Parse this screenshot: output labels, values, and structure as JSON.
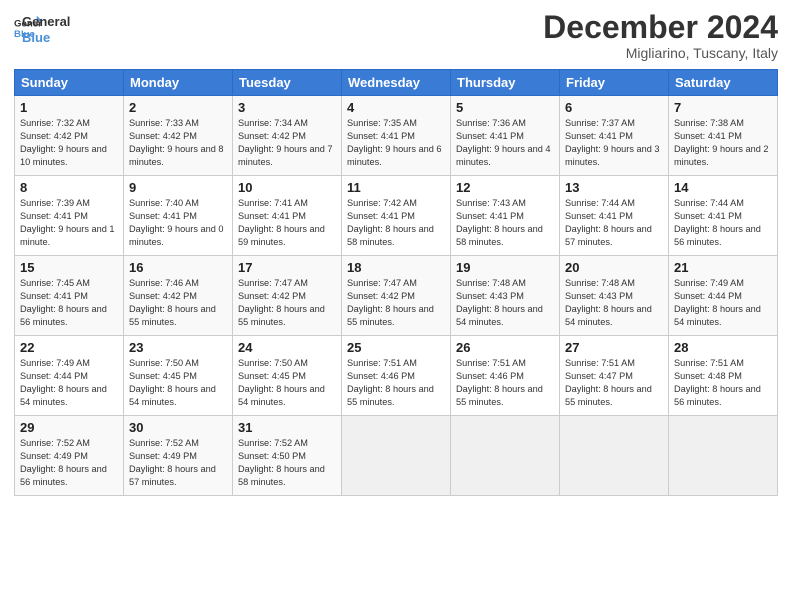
{
  "logo": {
    "line1": "General",
    "line2": "Blue"
  },
  "title": "December 2024",
  "location": "Migliarino, Tuscany, Italy",
  "days_of_week": [
    "Sunday",
    "Monday",
    "Tuesday",
    "Wednesday",
    "Thursday",
    "Friday",
    "Saturday"
  ],
  "weeks": [
    [
      {
        "day": "1",
        "info": "Sunrise: 7:32 AM\nSunset: 4:42 PM\nDaylight: 9 hours and 10 minutes."
      },
      {
        "day": "2",
        "info": "Sunrise: 7:33 AM\nSunset: 4:42 PM\nDaylight: 9 hours and 8 minutes."
      },
      {
        "day": "3",
        "info": "Sunrise: 7:34 AM\nSunset: 4:42 PM\nDaylight: 9 hours and 7 minutes."
      },
      {
        "day": "4",
        "info": "Sunrise: 7:35 AM\nSunset: 4:41 PM\nDaylight: 9 hours and 6 minutes."
      },
      {
        "day": "5",
        "info": "Sunrise: 7:36 AM\nSunset: 4:41 PM\nDaylight: 9 hours and 4 minutes."
      },
      {
        "day": "6",
        "info": "Sunrise: 7:37 AM\nSunset: 4:41 PM\nDaylight: 9 hours and 3 minutes."
      },
      {
        "day": "7",
        "info": "Sunrise: 7:38 AM\nSunset: 4:41 PM\nDaylight: 9 hours and 2 minutes."
      }
    ],
    [
      {
        "day": "8",
        "info": "Sunrise: 7:39 AM\nSunset: 4:41 PM\nDaylight: 9 hours and 1 minute."
      },
      {
        "day": "9",
        "info": "Sunrise: 7:40 AM\nSunset: 4:41 PM\nDaylight: 9 hours and 0 minutes."
      },
      {
        "day": "10",
        "info": "Sunrise: 7:41 AM\nSunset: 4:41 PM\nDaylight: 8 hours and 59 minutes."
      },
      {
        "day": "11",
        "info": "Sunrise: 7:42 AM\nSunset: 4:41 PM\nDaylight: 8 hours and 58 minutes."
      },
      {
        "day": "12",
        "info": "Sunrise: 7:43 AM\nSunset: 4:41 PM\nDaylight: 8 hours and 58 minutes."
      },
      {
        "day": "13",
        "info": "Sunrise: 7:44 AM\nSunset: 4:41 PM\nDaylight: 8 hours and 57 minutes."
      },
      {
        "day": "14",
        "info": "Sunrise: 7:44 AM\nSunset: 4:41 PM\nDaylight: 8 hours and 56 minutes."
      }
    ],
    [
      {
        "day": "15",
        "info": "Sunrise: 7:45 AM\nSunset: 4:41 PM\nDaylight: 8 hours and 56 minutes."
      },
      {
        "day": "16",
        "info": "Sunrise: 7:46 AM\nSunset: 4:42 PM\nDaylight: 8 hours and 55 minutes."
      },
      {
        "day": "17",
        "info": "Sunrise: 7:47 AM\nSunset: 4:42 PM\nDaylight: 8 hours and 55 minutes."
      },
      {
        "day": "18",
        "info": "Sunrise: 7:47 AM\nSunset: 4:42 PM\nDaylight: 8 hours and 55 minutes."
      },
      {
        "day": "19",
        "info": "Sunrise: 7:48 AM\nSunset: 4:43 PM\nDaylight: 8 hours and 54 minutes."
      },
      {
        "day": "20",
        "info": "Sunrise: 7:48 AM\nSunset: 4:43 PM\nDaylight: 8 hours and 54 minutes."
      },
      {
        "day": "21",
        "info": "Sunrise: 7:49 AM\nSunset: 4:44 PM\nDaylight: 8 hours and 54 minutes."
      }
    ],
    [
      {
        "day": "22",
        "info": "Sunrise: 7:49 AM\nSunset: 4:44 PM\nDaylight: 8 hours and 54 minutes."
      },
      {
        "day": "23",
        "info": "Sunrise: 7:50 AM\nSunset: 4:45 PM\nDaylight: 8 hours and 54 minutes."
      },
      {
        "day": "24",
        "info": "Sunrise: 7:50 AM\nSunset: 4:45 PM\nDaylight: 8 hours and 54 minutes."
      },
      {
        "day": "25",
        "info": "Sunrise: 7:51 AM\nSunset: 4:46 PM\nDaylight: 8 hours and 55 minutes."
      },
      {
        "day": "26",
        "info": "Sunrise: 7:51 AM\nSunset: 4:46 PM\nDaylight: 8 hours and 55 minutes."
      },
      {
        "day": "27",
        "info": "Sunrise: 7:51 AM\nSunset: 4:47 PM\nDaylight: 8 hours and 55 minutes."
      },
      {
        "day": "28",
        "info": "Sunrise: 7:51 AM\nSunset: 4:48 PM\nDaylight: 8 hours and 56 minutes."
      }
    ],
    [
      {
        "day": "29",
        "info": "Sunrise: 7:52 AM\nSunset: 4:49 PM\nDaylight: 8 hours and 56 minutes."
      },
      {
        "day": "30",
        "info": "Sunrise: 7:52 AM\nSunset: 4:49 PM\nDaylight: 8 hours and 57 minutes."
      },
      {
        "day": "31",
        "info": "Sunrise: 7:52 AM\nSunset: 4:50 PM\nDaylight: 8 hours and 58 minutes."
      },
      {
        "day": "",
        "info": ""
      },
      {
        "day": "",
        "info": ""
      },
      {
        "day": "",
        "info": ""
      },
      {
        "day": "",
        "info": ""
      }
    ]
  ]
}
